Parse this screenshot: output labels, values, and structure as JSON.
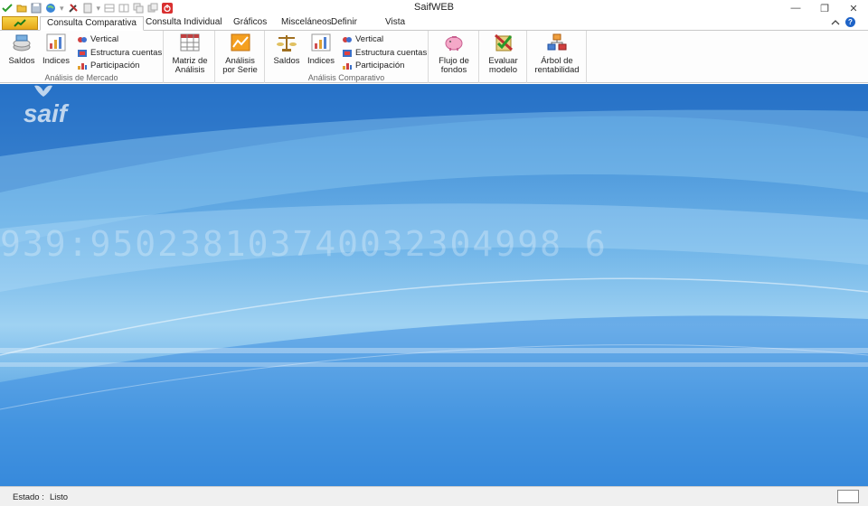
{
  "app": {
    "title": "SaifWEB"
  },
  "window_controls": {
    "minimize": "—",
    "restore": "❐",
    "close": "✕"
  },
  "tabs": [
    {
      "label": "Consulta Comparativa",
      "active": true
    },
    {
      "label": "Consulta Individual",
      "active": false
    },
    {
      "label": "Gráficos",
      "active": false
    },
    {
      "label": "Misceláneos",
      "active": false
    },
    {
      "label": "Definir",
      "active": false
    },
    {
      "label": "Vista",
      "active": false
    }
  ],
  "ribbon": {
    "analisis_mercado": {
      "label": "Análisis de Mercado",
      "saldos": "Saldos",
      "indices": "Indices",
      "vertical": "Vertical",
      "estructura": "Estructura cuentas",
      "participacion": "Participación"
    },
    "matriz": {
      "line1": "Matriz de",
      "line2": "Análisis"
    },
    "serie": {
      "line1": "Análisis",
      "line2": "por Serie"
    },
    "analisis_comparativo": {
      "label": "Análisis Comparativo",
      "saldos": "Saldos",
      "indices": "Indices",
      "vertical": "Vertical",
      "estructura": "Estructura cuentas",
      "participacion": "Participación"
    },
    "flujo": {
      "line1": "Flujo de",
      "line2": "fondos"
    },
    "evaluar": {
      "line1": "Evaluar",
      "line2": "modelo"
    },
    "arbol": {
      "line1": "Árbol de",
      "line2": "rentabilidad"
    }
  },
  "background": {
    "logo_text": "saif",
    "digits": "939:950238103740032304998 6"
  },
  "status": {
    "label": "Estado :",
    "value": "Listo"
  },
  "colors": {
    "accent": "#2f7fd0",
    "file_tab": "#e6a817"
  }
}
